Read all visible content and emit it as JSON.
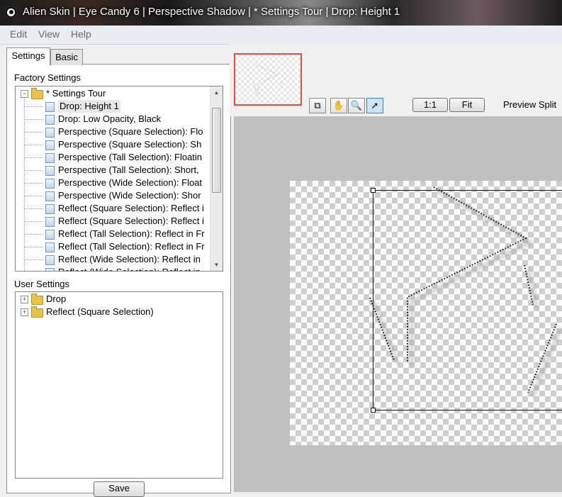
{
  "window": {
    "title": "Alien Skin | Eye Candy 6 | Perspective Shadow | * Settings Tour | Drop: Height 1"
  },
  "menu": {
    "items": [
      "Edit",
      "View",
      "Help"
    ]
  },
  "tabs": [
    "Settings",
    "Basic"
  ],
  "factory": {
    "label": "Factory Settings",
    "root": "* Settings Tour",
    "items": [
      "Drop: Height 1",
      "Drop: Low Opacity, Black",
      "Perspective (Square Selection): Flo",
      "Perspective (Square Selection): Sh",
      "Perspective (Tall Selection): Floatin",
      "Perspective (Tall Selection): Short,",
      "Perspective (Wide Selection): Float",
      "Perspective (Wide Selection): Shor",
      "Reflect (Square Selection): Reflect i",
      "Reflect (Square Selection): Reflect i",
      "Reflect (Tall Selection): Reflect in Fr",
      "Reflect (Tall Selection): Reflect in Fr",
      "Reflect (Wide Selection): Reflect in",
      "Reflect (Wide Selection): Reflect in"
    ],
    "selected_index": 0
  },
  "user": {
    "label": "User Settings",
    "folders": [
      "Drop",
      "Reflect (Square Selection)"
    ]
  },
  "buttons": {
    "save": "Save",
    "zoom_1_1": "1:1",
    "fit": "Fit"
  },
  "preview": {
    "split_label": "Preview Split"
  },
  "tools": [
    "pan-preview-tool",
    "hand-tool",
    "zoom-tool",
    "arrow-tool"
  ],
  "colors": {
    "nav_frame": "#e84a3c",
    "preview_bg": "#c0c0c0",
    "selected_tool": "#cce4f7"
  }
}
